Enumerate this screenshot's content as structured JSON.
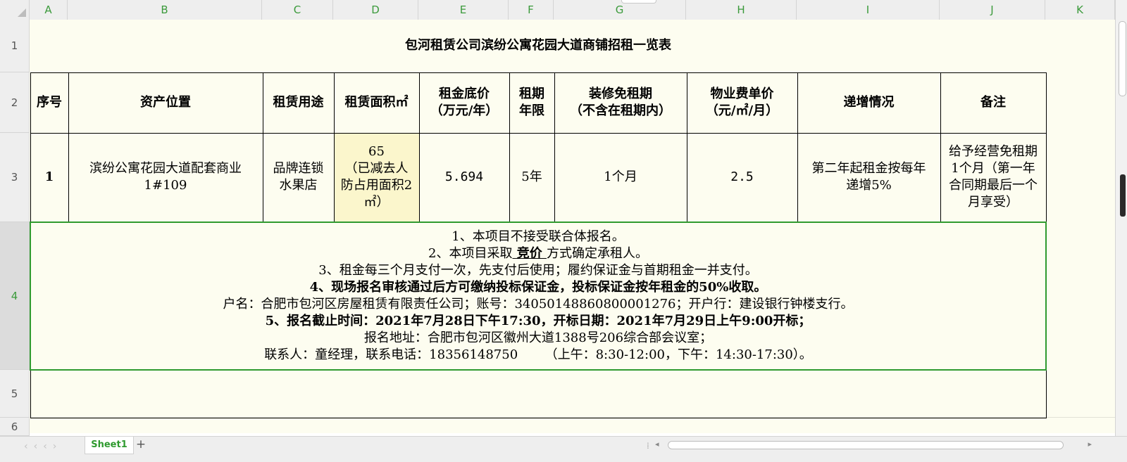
{
  "columns": [
    "A",
    "B",
    "C",
    "D",
    "E",
    "F",
    "G",
    "H",
    "I",
    "J",
    "K"
  ],
  "rows": [
    "1",
    "2",
    "3",
    "4",
    "5",
    "6"
  ],
  "title": "包河租赁公司滨纷公寓花园大道商铺招租一览表",
  "headers": {
    "seq": "序号",
    "location": "资产位置",
    "usage": "租赁用途",
    "area": "租赁面积㎡",
    "rent_1": "租金底价",
    "rent_2": "（万元/年）",
    "term_1": "租期",
    "term_2": "年限",
    "free_1": "装修免租期",
    "free_2": "（不含在租期内）",
    "fee_1": "物业费单价",
    "fee_2": "（元/㎡/月）",
    "increase": "递增情况",
    "remark": "备注"
  },
  "record": {
    "seq": "1",
    "location_1": "滨纷公寓花园大道配套商业",
    "location_2": "1#109",
    "usage_1": "品牌连锁",
    "usage_2": "水果店",
    "area_1": "65",
    "area_2": "（已减去人",
    "area_3": "防占用面积2",
    "area_4": "㎡）",
    "rent": "5.694",
    "term": "5年",
    "free": "1个月",
    "fee": "2.5",
    "increase_1": "第二年起租金按每年",
    "increase_2": "递增5%",
    "remark_1": "给予经营免租期",
    "remark_2": "1个月（第一年",
    "remark_3": "合同期最后一个",
    "remark_4": "月享受）"
  },
  "notes": {
    "line1": "1、本项目不接受联合体报名。",
    "line2_pre": "2、本项目采取",
    "line2_u": " 竞价 ",
    "line2_post": "方式确定承租人。",
    "line3": "3、租金每三个月支付一次，先支付后使用；履约保证金与首期租金一并支付。",
    "line4": "4、现场报名审核通过后方可缴纳投标保证金，投标保证金按年租金的50%收取。",
    "line5": "户名：合肥市包河区房屋租赁有限责任公司；账号：34050148860800001276；开户行：建设银行钟楼支行。",
    "line6": "5、报名截止时间：2021年7月28日下午17:30，开标日期：2021年7月29日上午9:00开标；",
    "line7": "报名地址：合肥市包河区徽州大道1388号206综合部会议室；",
    "line8": "联系人：童经理，联系电话：18356148750 　 　（上午：8:30-12:00，下午：14:30-17:30）。"
  },
  "sheet_tab": "Sheet1",
  "add_sheet": "+",
  "colors": {
    "header_green": "#3b9a3b",
    "sheet_bg": "#fdfdf0",
    "area_highlight": "#fbf6cc"
  }
}
